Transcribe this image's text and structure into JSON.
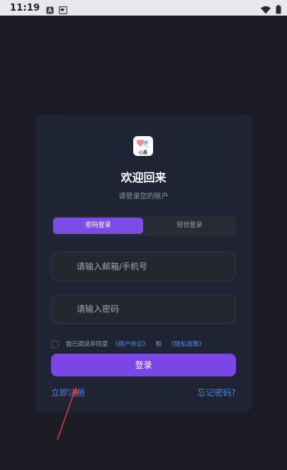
{
  "status_bar": {
    "time": "11:19",
    "left_icons": [
      "a-notification-icon",
      "screen-notification-icon"
    ],
    "right_icons": [
      "wifi-icon",
      "battery-icon"
    ]
  },
  "card": {
    "logo_text": "心盾",
    "title": "欢迎回来",
    "subtitle": "请登录您的账户",
    "tabs": [
      {
        "label": "密码登录",
        "active": true
      },
      {
        "label": "短信登录",
        "active": false
      }
    ],
    "account_placeholder": "请输入邮箱/手机号",
    "password_placeholder": "请输入密码",
    "agreement": {
      "prefix": "我已阅读并同意",
      "user_agreement": "《用户协议》",
      "and": "和",
      "privacy_policy": "《隐私政策》"
    },
    "login_label": "登录",
    "register_label": "立即注册",
    "forgot_label": "忘记密码?"
  },
  "colors": {
    "background": "#1d1b24",
    "card": "#1e2434",
    "accent": "#7c45e6",
    "link": "#4f82e8",
    "annotation_arrow": "#d9363e"
  }
}
